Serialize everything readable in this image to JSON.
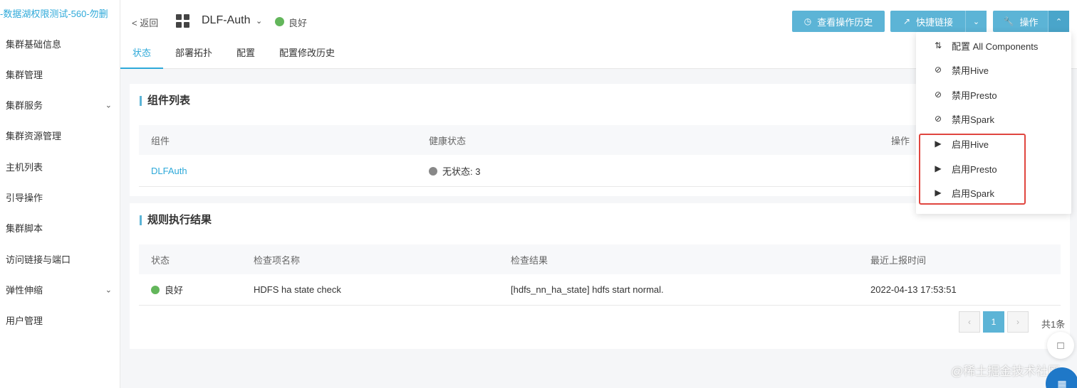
{
  "sidebar": {
    "title": "-数据湖权限测试-560-勿删",
    "items": [
      {
        "label": "集群基础信息",
        "chevron": false
      },
      {
        "label": "集群管理",
        "chevron": false
      },
      {
        "label": "集群服务",
        "chevron": true
      },
      {
        "label": "集群资源管理",
        "chevron": false
      },
      {
        "label": "主机列表",
        "chevron": false
      },
      {
        "label": "引导操作",
        "chevron": false
      },
      {
        "label": "集群脚本",
        "chevron": false
      },
      {
        "label": "访问链接与端口",
        "chevron": false
      },
      {
        "label": "弹性伸缩",
        "chevron": true
      },
      {
        "label": "用户管理",
        "chevron": false
      }
    ]
  },
  "header": {
    "back_label": "< 返回",
    "app_name": "DLF-Auth",
    "status_label": "良好",
    "buttons": {
      "history": "查看操作历史",
      "quick_link": "快捷链接",
      "operate": "操作"
    }
  },
  "tabs": [
    "状态",
    "部署拓扑",
    "配置",
    "配置修改历史"
  ],
  "components": {
    "title": "组件列表",
    "headers": [
      "组件",
      "健康状态",
      "操作"
    ],
    "rows": [
      {
        "name": "DLFAuth",
        "status": "无状态: 3"
      }
    ]
  },
  "rules": {
    "title": "规则执行结果",
    "headers": [
      "状态",
      "检查项名称",
      "检查结果",
      "最近上报时间"
    ],
    "rows": [
      {
        "status": "良好",
        "name": "HDFS ha state check",
        "result": "[hdfs_nn_ha_state] hdfs start normal.",
        "time": "2022-04-13 17:53:51"
      }
    ]
  },
  "pagination": {
    "current": "1",
    "total": "共1条"
  },
  "dropdown": [
    {
      "label": "配置 All Components",
      "icon": "sliders-icon"
    },
    {
      "label": "禁用Hive",
      "icon": "ban-icon"
    },
    {
      "label": "禁用Presto",
      "icon": "ban-icon"
    },
    {
      "label": "禁用Spark",
      "icon": "ban-icon"
    },
    {
      "label": "启用Hive",
      "icon": "play-icon"
    },
    {
      "label": "启用Presto",
      "icon": "play-icon"
    },
    {
      "label": "启用Spark",
      "icon": "play-icon"
    }
  ],
  "colors": {
    "accent": "#5cb4d6",
    "good": "#63b65b",
    "neutral": "#888888",
    "highlight": "#e0453f"
  },
  "watermark": "@稀土掘金技术社区"
}
